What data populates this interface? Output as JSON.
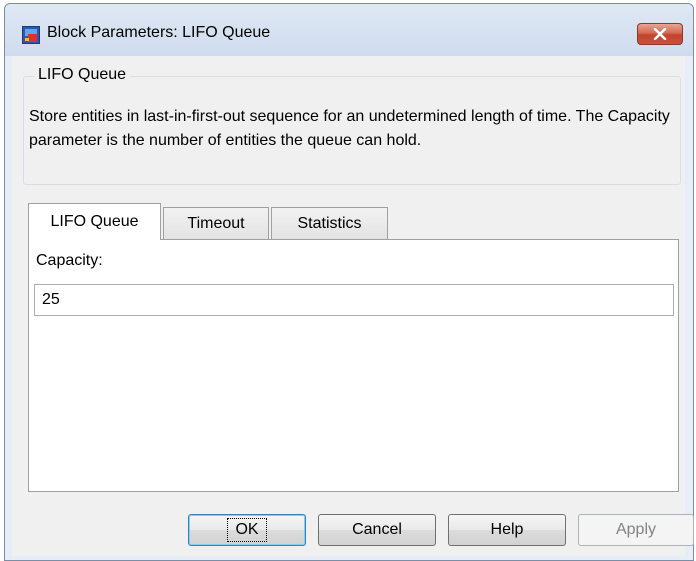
{
  "window": {
    "title": "Block Parameters: LIFO Queue",
    "icon": "simulink-block-icon",
    "close_icon": "close-icon"
  },
  "group": {
    "legend": "LIFO Queue",
    "description": "Store entities in last-in-first-out sequence for an undetermined length of time. The Capacity parameter is the number of entities the queue can hold."
  },
  "tabs": [
    {
      "label": "LIFO Queue",
      "active": true
    },
    {
      "label": "Timeout",
      "active": false
    },
    {
      "label": "Statistics",
      "active": false
    }
  ],
  "panel": {
    "capacity_label": "Capacity:",
    "capacity_value": "25"
  },
  "buttons": {
    "ok": "OK",
    "cancel": "Cancel",
    "help": "Help",
    "apply": "Apply"
  },
  "colors": {
    "close_button": "#c9533b",
    "window_frame": "#e6edf6",
    "dialog_background": "#f0f0f0"
  }
}
